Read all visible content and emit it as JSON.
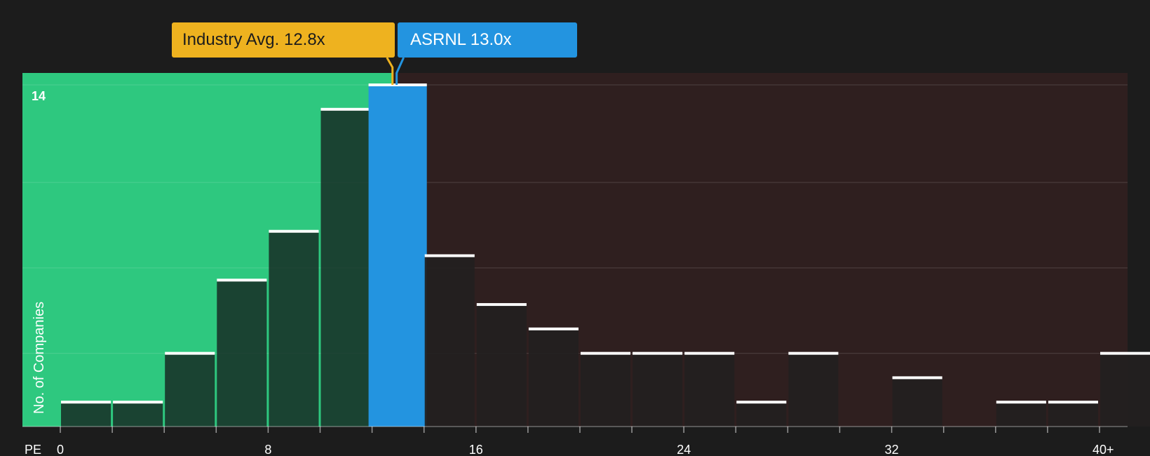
{
  "chart_data": {
    "type": "bar",
    "title": "",
    "xlabel": "PE",
    "ylabel": "No. of Companies",
    "x_ticks": [
      "0",
      "8",
      "16",
      "24",
      "32",
      "40+"
    ],
    "y_ticks": [
      "14"
    ],
    "ylim": [
      0,
      14
    ],
    "grid": true,
    "bin_width": 2,
    "bins": [
      {
        "start": 0,
        "count": 1
      },
      {
        "start": 2,
        "count": 1
      },
      {
        "start": 4,
        "count": 3
      },
      {
        "start": 6,
        "count": 6
      },
      {
        "start": 8,
        "count": 8
      },
      {
        "start": 10,
        "count": 13
      },
      {
        "start": 12,
        "count": 14,
        "highlight": true
      },
      {
        "start": 14,
        "count": 7
      },
      {
        "start": 16,
        "count": 5
      },
      {
        "start": 18,
        "count": 4
      },
      {
        "start": 20,
        "count": 3
      },
      {
        "start": 22,
        "count": 3
      },
      {
        "start": 24,
        "count": 3
      },
      {
        "start": 26,
        "count": 1
      },
      {
        "start": 28,
        "count": 3
      },
      {
        "start": 30,
        "count": 0
      },
      {
        "start": 32,
        "count": 2
      },
      {
        "start": 34,
        "count": 0
      },
      {
        "start": 36,
        "count": 1
      },
      {
        "start": 38,
        "count": 1
      },
      {
        "start": 40,
        "count": 3
      }
    ],
    "industry_avg": {
      "label": "Industry Avg. 12.8x",
      "value": 12.8
    },
    "company": {
      "label": "ASRNL 13.0x",
      "value": 13.0
    },
    "colors": {
      "background": "#1c1c1c",
      "undervalued_zone": "#2ec87f",
      "overvalued_zone": "#2f1f1f",
      "highlight_bar": "#2394e0",
      "industry_marker": "#eeb21f",
      "bar_top": "#ffffff"
    }
  }
}
